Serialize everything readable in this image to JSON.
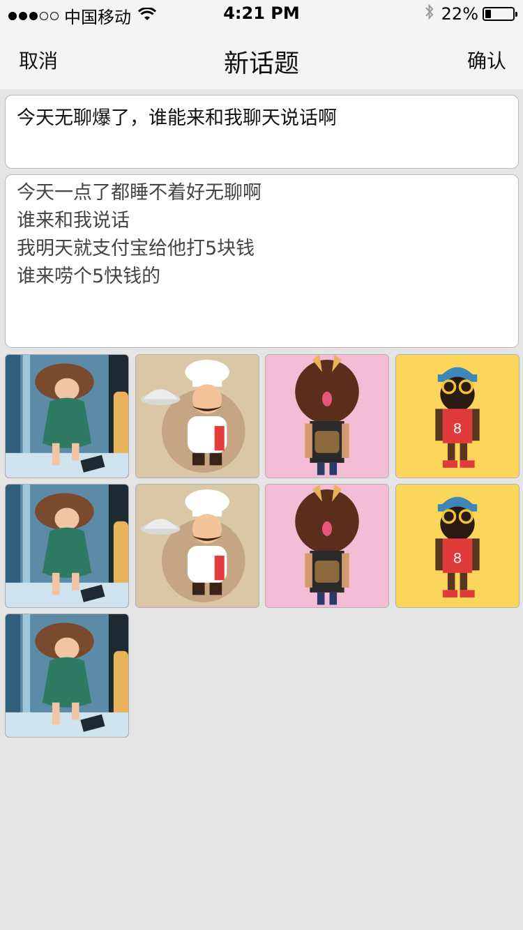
{
  "status_bar": {
    "carrier": "中国移动",
    "time": "4:21 PM",
    "battery_percent": "22%",
    "battery_level": 0.22,
    "signal_bars_filled": 3,
    "signal_bars_total": 5,
    "icons": [
      "wifi-icon",
      "bluetooth-icon",
      "battery-icon"
    ]
  },
  "nav": {
    "cancel_label": "取消",
    "title": "新话题",
    "confirm_label": "确认"
  },
  "form": {
    "title_value": "今天无聊爆了，谁能来和我聊天说话啊",
    "content_lines": [
      "今天一点了都睡不着好无聊啊",
      "谁来和我说话",
      "我明天就支付宝给他打5块钱",
      "谁来唠个5快钱的"
    ]
  },
  "images": [
    {
      "kind": "sleeping-girl",
      "bg": "#5b8ba7"
    },
    {
      "kind": "chef",
      "bg": "#d9c7a6"
    },
    {
      "kind": "afro-man",
      "bg": "#f5bcd6"
    },
    {
      "kind": "bearded-man",
      "bg": "#fcd65b"
    },
    {
      "kind": "sleeping-girl",
      "bg": "#5b8ba7"
    },
    {
      "kind": "chef",
      "bg": "#d9c7a6"
    },
    {
      "kind": "afro-man",
      "bg": "#f5bcd6"
    },
    {
      "kind": "bearded-man",
      "bg": "#fcd65b"
    },
    {
      "kind": "sleeping-girl",
      "bg": "#5b8ba7"
    }
  ],
  "colors": {
    "page_bg": "#e5e5e5",
    "bar_bg": "#f4f4f4",
    "field_border": "#b9b9b9"
  }
}
